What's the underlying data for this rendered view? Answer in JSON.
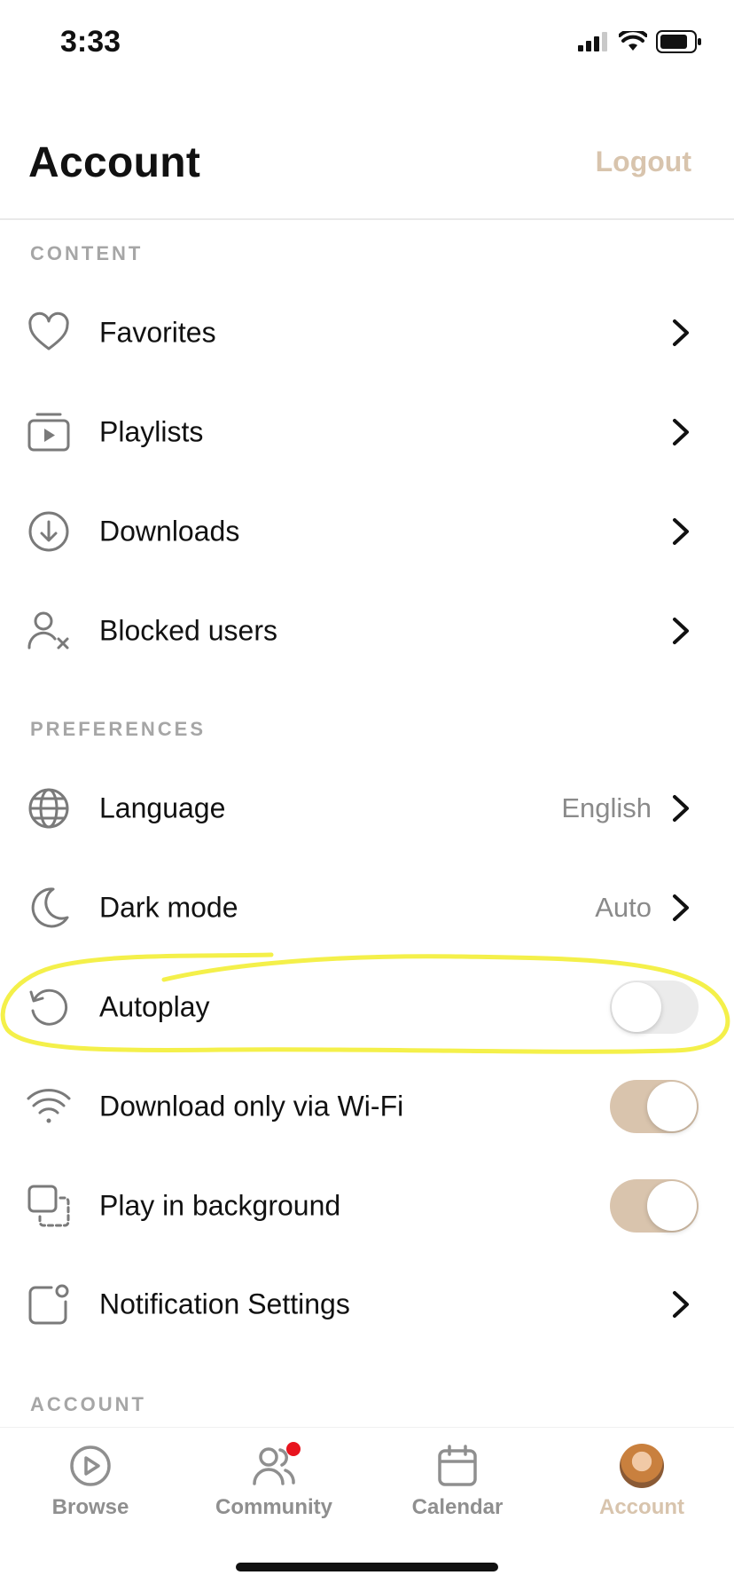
{
  "status_bar": {
    "time": "3:33"
  },
  "header": {
    "title": "Account",
    "logout_label": "Logout"
  },
  "sections": {
    "content": "CONTENT",
    "preferences": "PREFERENCES",
    "account": "ACCOUNT"
  },
  "content_items": [
    {
      "label": "Favorites",
      "icon": "heart-icon"
    },
    {
      "label": "Playlists",
      "icon": "playlist-icon"
    },
    {
      "label": "Downloads",
      "icon": "download-icon"
    },
    {
      "label": "Blocked users",
      "icon": "blocked-user-icon"
    }
  ],
  "preference_items": {
    "language": {
      "label": "Language",
      "value": "English",
      "icon": "globe-icon"
    },
    "dark_mode": {
      "label": "Dark mode",
      "value": "Auto",
      "icon": "moon-icon"
    },
    "autoplay": {
      "label": "Autoplay",
      "icon": "replay-icon",
      "enabled": false
    },
    "wifi_only": {
      "label": "Download only via Wi-Fi",
      "icon": "wifi-icon",
      "enabled": true
    },
    "background": {
      "label": "Play in background",
      "icon": "background-play-icon",
      "enabled": true
    },
    "notifications": {
      "label": "Notification Settings",
      "icon": "notification-icon"
    }
  },
  "tabs": [
    {
      "label": "Browse",
      "icon": "play-circle-icon",
      "active": false
    },
    {
      "label": "Community",
      "icon": "community-icon",
      "active": false,
      "has_badge": true
    },
    {
      "label": "Calendar",
      "icon": "calendar-icon",
      "active": false
    },
    {
      "label": "Account",
      "icon": "avatar",
      "active": true
    }
  ],
  "colors": {
    "accent": "#d8c4ad",
    "toggle_on": "#d9c4ad",
    "toggle_off": "#ebebeb",
    "annotation": "#f4f04a",
    "badge": "#e8141e",
    "muted_text": "#8a8a8a"
  }
}
